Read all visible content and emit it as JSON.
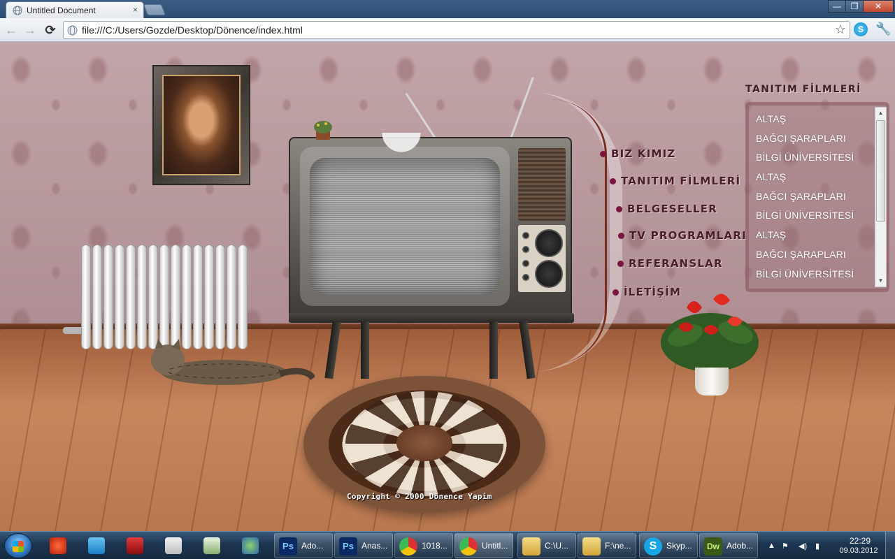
{
  "browser": {
    "tab_title": "Untitled Document",
    "tab_close": "×",
    "window_minimize": "—",
    "window_maximize": "❐",
    "window_close": "✕",
    "url": "file:///C:/Users/Gozde/Desktop/Dönence/index.html",
    "back": "←",
    "forward": "→",
    "reload": "⟳",
    "bookmark_star": "☆",
    "wrench": "🔧"
  },
  "site": {
    "menu": [
      {
        "label": "BIZ KIMIZ"
      },
      {
        "label": "TANITIM FİLMLERİ"
      },
      {
        "label": "BELGESELLER"
      },
      {
        "label": "TV PROGRAMLARI"
      },
      {
        "label": "REFERANSLAR"
      },
      {
        "label": "İLETİŞİM"
      }
    ],
    "films_title": "TANITIM FİLMLERİ",
    "films": [
      "ALTAŞ",
      "BAĞCI ŞARAPLARI",
      "BİLGİ ÜNİVERSİTESİ",
      "ALTAŞ",
      "BAĞCI ŞARAPLARI",
      "BİLGİ ÜNİVERSİTESİ",
      "ALTAŞ",
      "BAĞCI ŞARAPLARI",
      "BİLGİ ÜNİVERSİTESİ"
    ],
    "scroll_up": "▲",
    "scroll_down": "▼",
    "copyright": "Copyright © 2000 Dönence Yapim"
  },
  "taskbar": {
    "tasks": [
      {
        "label": "Ado...",
        "color": "#0b2a63",
        "glyph": "Ps"
      },
      {
        "label": "Anas...",
        "color": "#0b2a63",
        "glyph": "Ps"
      },
      {
        "label": "1018...",
        "color": "#d8d8d8",
        "glyph": "●"
      },
      {
        "label": "Untitl...",
        "color": "#d8d8d8",
        "glyph": "●"
      },
      {
        "label": "C:\\U...",
        "color": "#e8c65a",
        "glyph": "▮"
      },
      {
        "label": "F:\\ne...",
        "color": "#e8c65a",
        "glyph": "▮"
      },
      {
        "label": "Skyp...",
        "color": "#17a5e6",
        "glyph": "S"
      },
      {
        "label": "Adob...",
        "color": "#3c5a17",
        "glyph": "Dw"
      }
    ],
    "clock_time": "22:29",
    "clock_date": "09.03.2012"
  },
  "colors": {
    "menu_dot": "#7c1440",
    "menu_text": "#4b1e2c",
    "wall": "#b7989c",
    "floor": "#b9774f"
  }
}
